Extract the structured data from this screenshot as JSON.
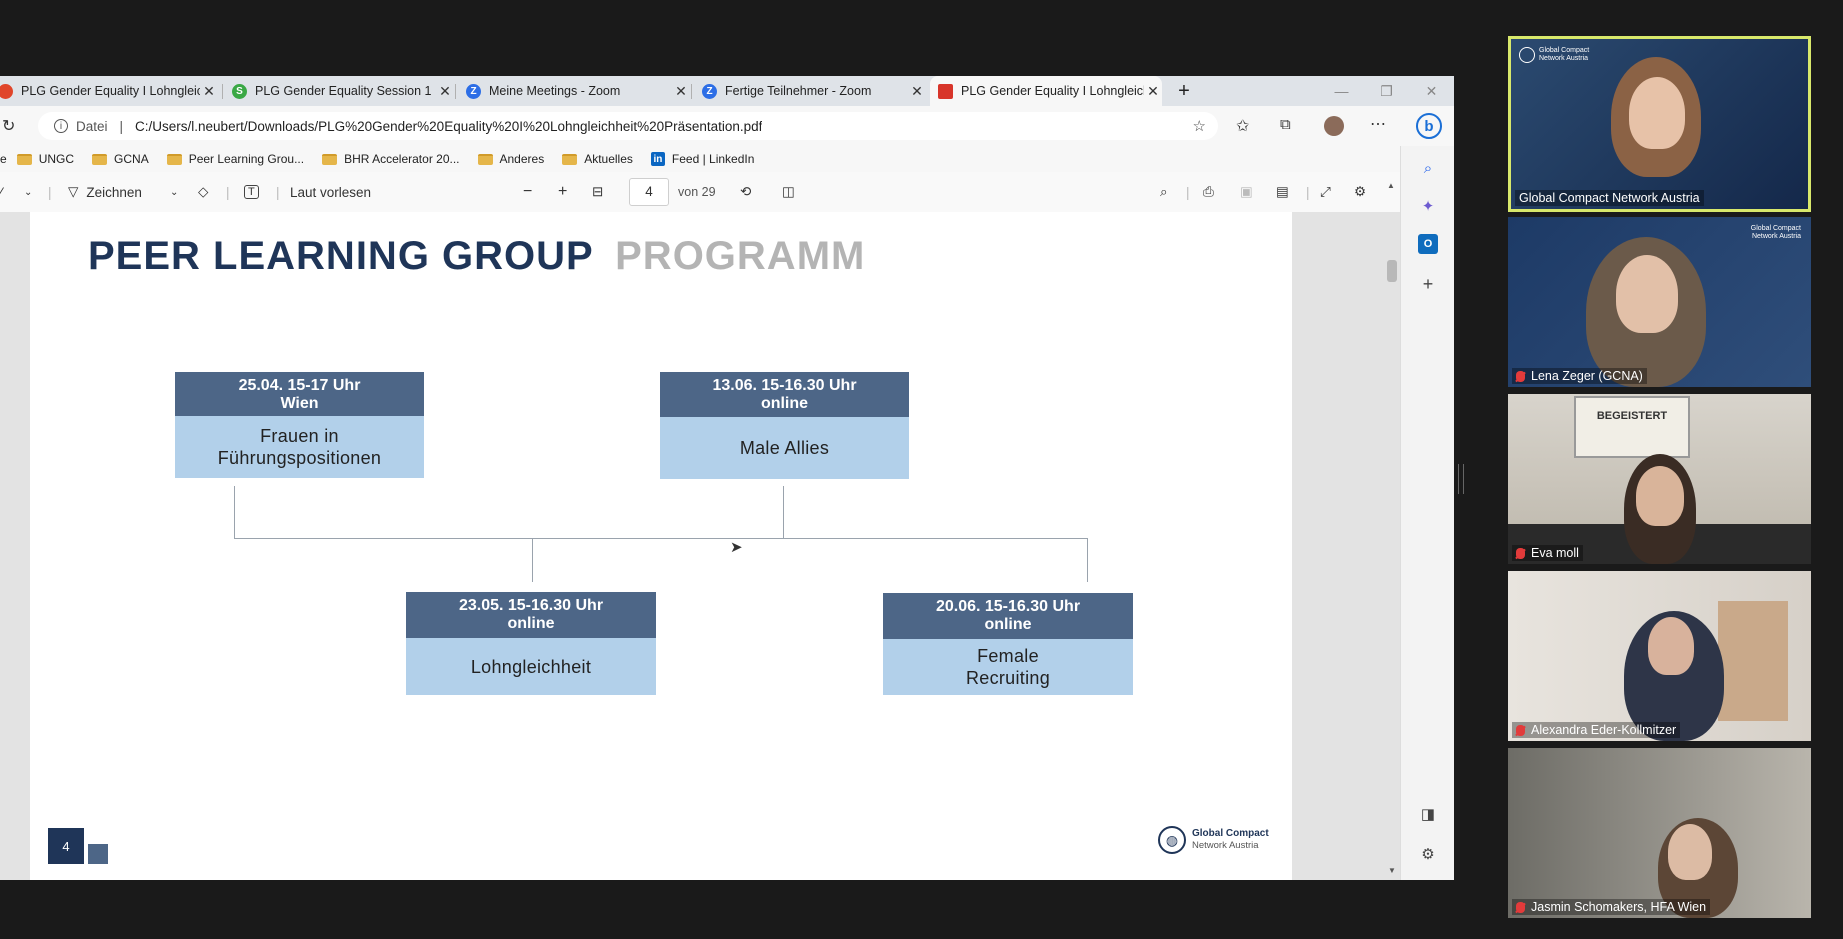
{
  "browser": {
    "tabs": [
      {
        "title": "PLG Gender Equality I Lohngleich",
        "icon": "pdf-icon",
        "color": "#e0452a"
      },
      {
        "title": "PLG Gender Equality Session 1",
        "icon": "s-icon",
        "color": "#3aa845"
      },
      {
        "title": "Meine Meetings - Zoom",
        "icon": "zoom-icon",
        "color": "#2d6ee6"
      },
      {
        "title": "Fertige Teilnehmer - Zoom",
        "icon": "zoom-icon",
        "color": "#2d6ee6"
      },
      {
        "title": "PLG Gender Equality I Lohngleich",
        "icon": "pdf-icon",
        "color": "#d8352a"
      }
    ],
    "new_tab": "+",
    "address": {
      "label": "Datei",
      "url": "C:/Users/l.neubert/Downloads/PLG%20Gender%20Equality%20I%20Lohngleichheit%20Präsentation.pdf"
    },
    "bookmarks": [
      "UNGC",
      "GCNA",
      "Peer Learning Grou...",
      "BHR Accelerator 20...",
      "Anderes",
      "Aktuelles",
      "Feed | LinkedIn"
    ],
    "bookmark_first": "e"
  },
  "pdf_toolbar": {
    "draw_label": "Zeichnen",
    "read_aloud_label": "Laut vorlesen",
    "page_current": "4",
    "page_total": "von 29"
  },
  "slide": {
    "title_dark": "PEER LEARNING GROUP",
    "title_light": "PROGRAMM",
    "colors": {
      "dark": "#1f3558",
      "light": "#b4b4b4",
      "header": "#4d6687",
      "body": "#b2d0ea"
    },
    "sessions": [
      {
        "date": "25.04. 15-17 Uhr",
        "place": "Wien",
        "topic_1": "Frauen in",
        "topic_2": "Führungspositionen"
      },
      {
        "date": "13.06. 15-16.30 Uhr",
        "place": "online",
        "topic_1": "Male Allies",
        "topic_2": ""
      },
      {
        "date": "23.05. 15-16.30 Uhr",
        "place": "online",
        "topic_1": "Lohngleichheit",
        "topic_2": ""
      },
      {
        "date": "20.06. 15-16.30 Uhr",
        "place": "online",
        "topic_1": "Female",
        "topic_2": "Recruiting"
      }
    ],
    "page_number": "4",
    "logo_line_1": "Global Compact",
    "logo_line_2": "Network Austria"
  },
  "participants": [
    {
      "name": "Global Compact Network Austria",
      "muted": false,
      "active": true
    },
    {
      "name": "Lena Zeger (GCNA)",
      "muted": true,
      "active": false
    },
    {
      "name": "Eva moll",
      "muted": true,
      "active": false
    },
    {
      "name": "Alexandra Eder-Kollmitzer",
      "muted": true,
      "active": false
    },
    {
      "name": "Jasmin Schomakers, HFA Wien",
      "muted": true,
      "active": false
    }
  ],
  "tile_text": {
    "gc_logo_1": "Global Compact",
    "gc_logo_2": "Network Austria",
    "sign_text": "BEGEISTERT"
  }
}
